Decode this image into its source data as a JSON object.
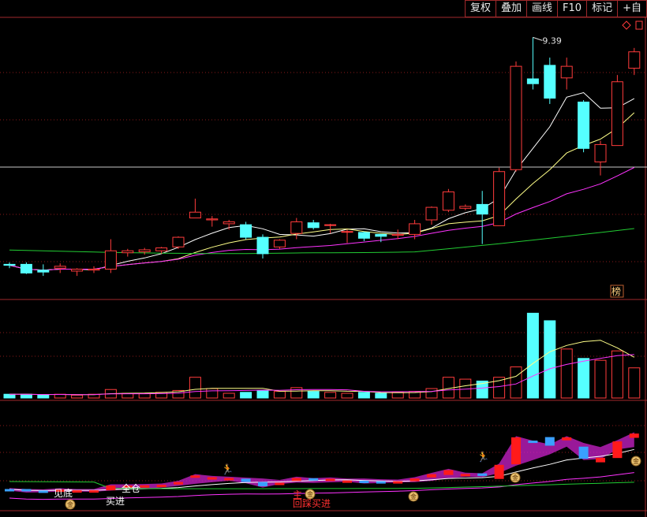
{
  "toolbar": {
    "buttons": [
      {
        "key": "restore_rights",
        "label": "复权"
      },
      {
        "key": "overlay",
        "label": "叠加"
      },
      {
        "key": "draw_line",
        "label": "画线"
      },
      {
        "key": "f10",
        "label": "F10"
      },
      {
        "key": "mark",
        "label": "标记"
      },
      {
        "key": "self_select",
        "label": "+自"
      }
    ]
  },
  "main_panel": {
    "high_label": "9.39",
    "rank_badge": "榜",
    "candles": [
      {
        "o": 7.04,
        "h": 7.06,
        "l": 7.0,
        "c": 7.03
      },
      {
        "o": 7.04,
        "h": 7.06,
        "l": 6.94,
        "c": 6.95
      },
      {
        "o": 6.98,
        "h": 7.04,
        "l": 6.92,
        "c": 6.96
      },
      {
        "o": 7.0,
        "h": 7.05,
        "l": 6.95,
        "c": 7.02
      },
      {
        "o": 6.97,
        "h": 7.0,
        "l": 6.92,
        "c": 6.99
      },
      {
        "o": 6.98,
        "h": 7.02,
        "l": 6.95,
        "c": 6.99
      },
      {
        "o": 6.99,
        "h": 7.3,
        "l": 6.95,
        "c": 7.18
      },
      {
        "o": 7.16,
        "h": 7.2,
        "l": 7.12,
        "c": 7.18
      },
      {
        "o": 7.17,
        "h": 7.21,
        "l": 7.14,
        "c": 7.19
      },
      {
        "o": 7.18,
        "h": 7.22,
        "l": 7.15,
        "c": 7.21
      },
      {
        "o": 7.22,
        "h": 7.33,
        "l": 7.2,
        "c": 7.32
      },
      {
        "o": 7.52,
        "h": 7.72,
        "l": 7.52,
        "c": 7.58
      },
      {
        "o": 7.5,
        "h": 7.54,
        "l": 7.43,
        "c": 7.51
      },
      {
        "o": 7.46,
        "h": 7.5,
        "l": 7.4,
        "c": 7.48
      },
      {
        "o": 7.45,
        "h": 7.48,
        "l": 7.3,
        "c": 7.32
      },
      {
        "o": 7.32,
        "h": 7.35,
        "l": 7.1,
        "c": 7.15
      },
      {
        "o": 7.22,
        "h": 7.3,
        "l": 7.2,
        "c": 7.29
      },
      {
        "o": 7.36,
        "h": 7.52,
        "l": 7.3,
        "c": 7.48
      },
      {
        "o": 7.47,
        "h": 7.5,
        "l": 7.4,
        "c": 7.42
      },
      {
        "o": 7.45,
        "h": 7.46,
        "l": 7.36,
        "c": 7.45
      },
      {
        "o": 7.38,
        "h": 7.4,
        "l": 7.26,
        "c": 7.38
      },
      {
        "o": 7.37,
        "h": 7.38,
        "l": 7.28,
        "c": 7.31
      },
      {
        "o": 7.35,
        "h": 7.35,
        "l": 7.27,
        "c": 7.33
      },
      {
        "o": 7.34,
        "h": 7.4,
        "l": 7.3,
        "c": 7.35
      },
      {
        "o": 7.35,
        "h": 7.5,
        "l": 7.3,
        "c": 7.46
      },
      {
        "o": 7.5,
        "h": 7.64,
        "l": 7.45,
        "c": 7.63
      },
      {
        "o": 7.6,
        "h": 7.82,
        "l": 7.58,
        "c": 7.79
      },
      {
        "o": 7.62,
        "h": 7.66,
        "l": 7.6,
        "c": 7.64
      },
      {
        "o": 7.66,
        "h": 7.8,
        "l": 7.25,
        "c": 7.56
      },
      {
        "o": 7.44,
        "h": 8.04,
        "l": 7.44,
        "c": 8.0
      },
      {
        "o": 8.02,
        "h": 9.14,
        "l": 8.0,
        "c": 9.09
      },
      {
        "o": 8.96,
        "h": 9.39,
        "l": 8.85,
        "c": 8.91
      },
      {
        "o": 9.1,
        "h": 9.18,
        "l": 8.7,
        "c": 8.76
      },
      {
        "o": 8.97,
        "h": 9.18,
        "l": 8.85,
        "c": 9.09
      },
      {
        "o": 8.72,
        "h": 8.74,
        "l": 8.2,
        "c": 8.24
      },
      {
        "o": 8.1,
        "h": 8.32,
        "l": 7.96,
        "c": 8.28
      },
      {
        "o": 8.27,
        "h": 9.0,
        "l": 8.27,
        "c": 8.93
      },
      {
        "o": 9.07,
        "h": 9.28,
        "l": 9.0,
        "c": 9.24
      }
    ],
    "volumes": [
      4,
      4,
      3,
      4,
      3,
      4,
      9,
      5,
      5,
      6,
      8,
      22,
      10,
      5,
      6,
      8,
      7,
      11,
      7,
      6,
      5,
      6,
      5,
      6,
      7,
      10,
      22,
      20,
      18,
      22,
      33,
      90,
      82,
      52,
      42,
      40,
      50,
      32
    ]
  },
  "indicator_panel": {
    "signal_labels": {
      "bottom_seen": "见底",
      "full_position": "全仓",
      "buy_in": "买进",
      "main_force": "主",
      "pullback_buy": "回踩买进",
      "money_icon": "金"
    }
  },
  "colors": {
    "up": "#ff3b3b",
    "down": "#55ffff",
    "ma_white": "#ffffff",
    "ma_yellow": "#ffff88",
    "ma_magenta": "#ff33ff",
    "ma_green": "#22cc33",
    "grid": "#8a1a1a",
    "border": "#a0292b"
  }
}
